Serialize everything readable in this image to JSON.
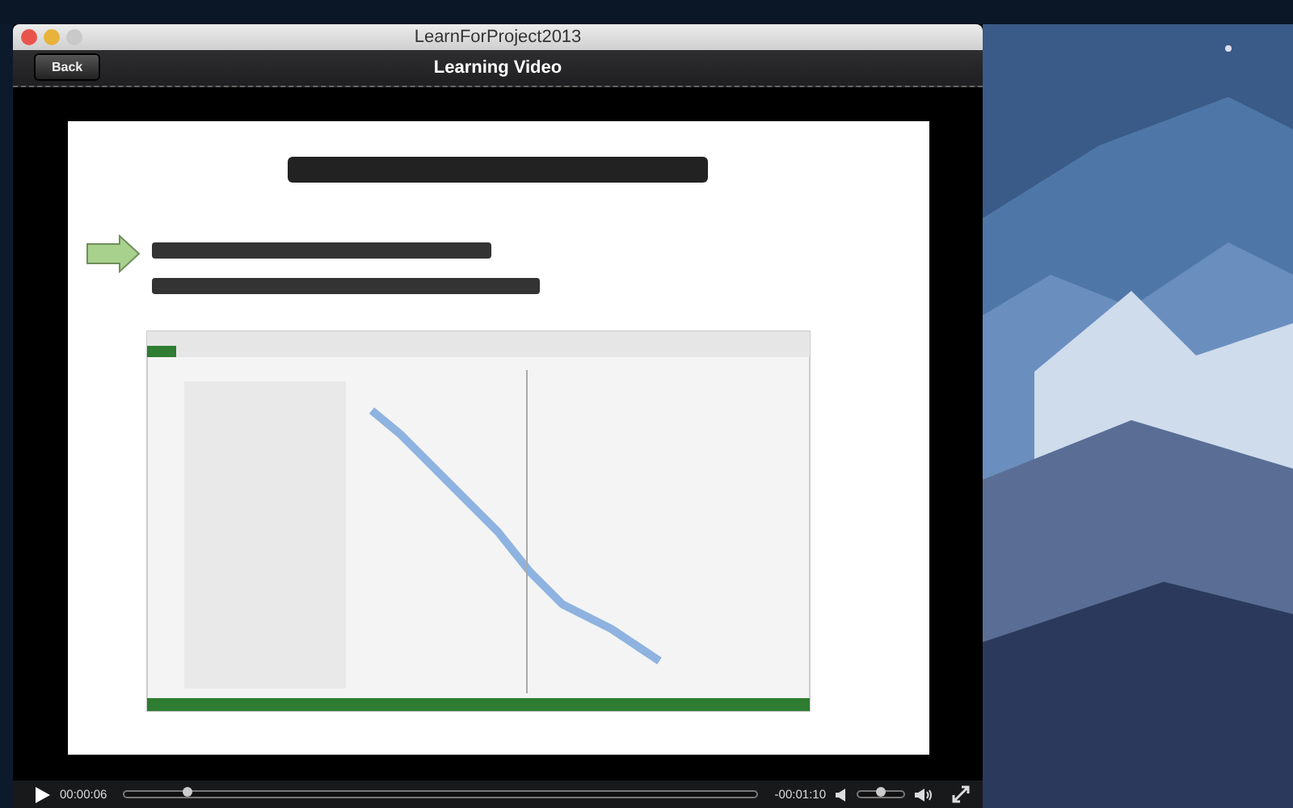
{
  "window": {
    "title": "LearnForProject2013"
  },
  "header": {
    "back_button": "Back",
    "title": "Learning Video"
  },
  "player": {
    "elapsed": "00:00:06",
    "remaining": "-00:01:10",
    "progress": {
      "level": 0.1
    },
    "volume": {
      "level": 0.5
    }
  }
}
